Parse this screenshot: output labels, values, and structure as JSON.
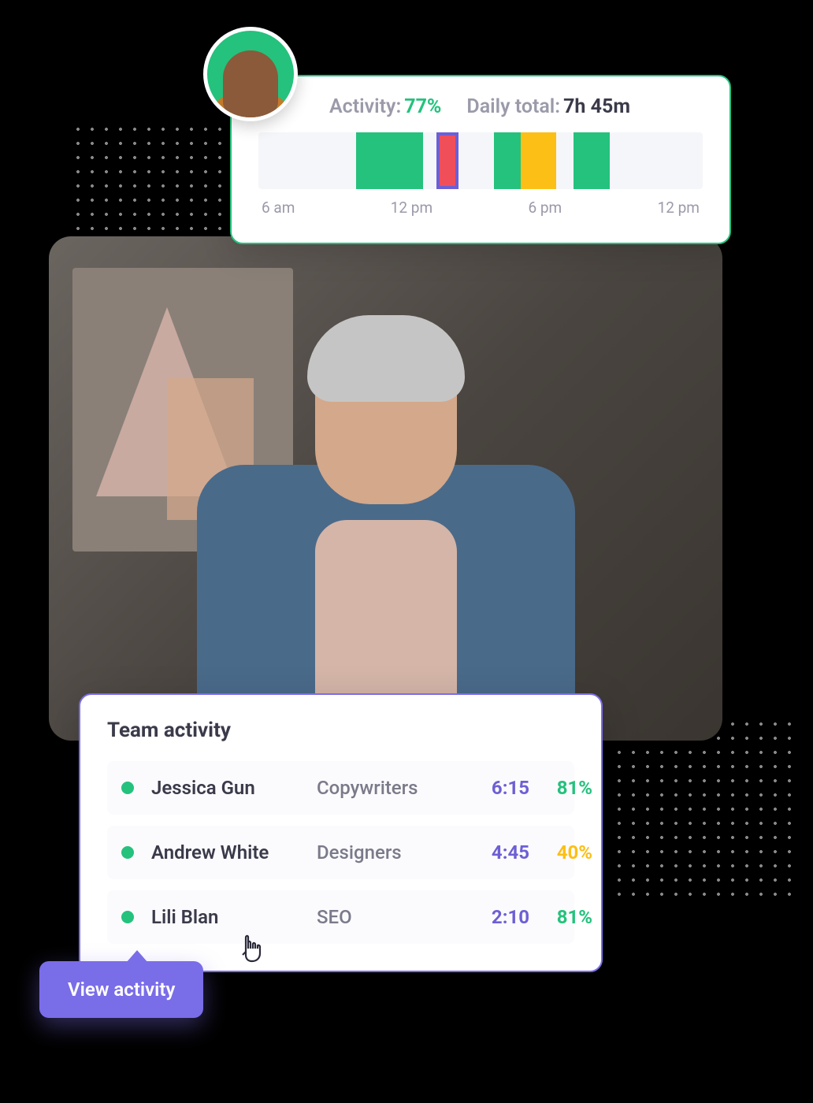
{
  "activity_card": {
    "activity_label": "Activity:",
    "activity_value": "77%",
    "daily_total_label": "Daily total:",
    "daily_total_value": "7h 45m",
    "timeline": {
      "labels": [
        "6 am",
        "12 pm",
        "6 pm",
        "12 pm"
      ],
      "blocks": [
        {
          "left_pct": 22,
          "width_pct": 15,
          "color": "green"
        },
        {
          "left_pct": 40,
          "width_pct": 5,
          "color": "red"
        },
        {
          "left_pct": 53,
          "width_pct": 6,
          "color": "green"
        },
        {
          "left_pct": 59,
          "width_pct": 8,
          "color": "yellow"
        },
        {
          "left_pct": 71,
          "width_pct": 8,
          "color": "green"
        }
      ]
    }
  },
  "team_card": {
    "title": "Team activity",
    "rows": [
      {
        "name": "Jessica Gun",
        "role": "Copywriters",
        "time": "6:15",
        "pct": "81%",
        "pct_color": "green"
      },
      {
        "name": "Andrew White",
        "role": "Designers",
        "time": "4:45",
        "pct": "40%",
        "pct_color": "yellow"
      },
      {
        "name": "Lili Blan",
        "role": "SEO",
        "time": "2:10",
        "pct": "81%",
        "pct_color": "green"
      }
    ]
  },
  "tooltip": {
    "label": "View activity"
  },
  "colors": {
    "green": "#24c27d",
    "yellow": "#fcbf15",
    "red": "#f04f5a",
    "purple": "#7a6de8"
  }
}
